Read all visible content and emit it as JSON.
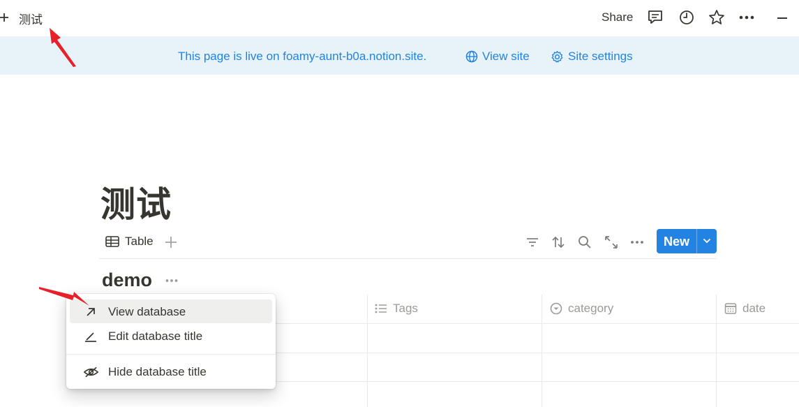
{
  "topbar": {
    "breadcrumb": "测试",
    "share_label": "Share",
    "icons": [
      "plus-icon",
      "comment-icon",
      "history-icon",
      "star-icon",
      "more-icon",
      "minimize-icon"
    ]
  },
  "banner": {
    "text": "This page is live on foamy-aunt-b0a.notion.site.",
    "view_site_label": "View site",
    "site_settings_label": "Site settings"
  },
  "page": {
    "title": "测试"
  },
  "view_toolbar": {
    "tab_label": "Table",
    "new_label": "New",
    "tools": [
      "filter-icon",
      "sort-icon",
      "search-icon",
      "expand-icon",
      "more-icon"
    ]
  },
  "database": {
    "title": "demo",
    "columns": [
      {
        "label": "Tags",
        "icon": "list-icon"
      },
      {
        "label": "category",
        "icon": "select-icon"
      },
      {
        "label": "date",
        "icon": "calendar-icon"
      }
    ]
  },
  "context_menu": {
    "items": [
      {
        "label": "View database",
        "icon": "arrow-up-right-icon",
        "highlighted": true
      },
      {
        "label": "Edit database title",
        "icon": "edit-icon"
      },
      {
        "label": "Hide database title",
        "icon": "eye-off-icon"
      }
    ]
  },
  "colors": {
    "accent": "#2383e2",
    "banner_bg": "#e7f3f8",
    "annotation_arrow": "#e8202a"
  }
}
